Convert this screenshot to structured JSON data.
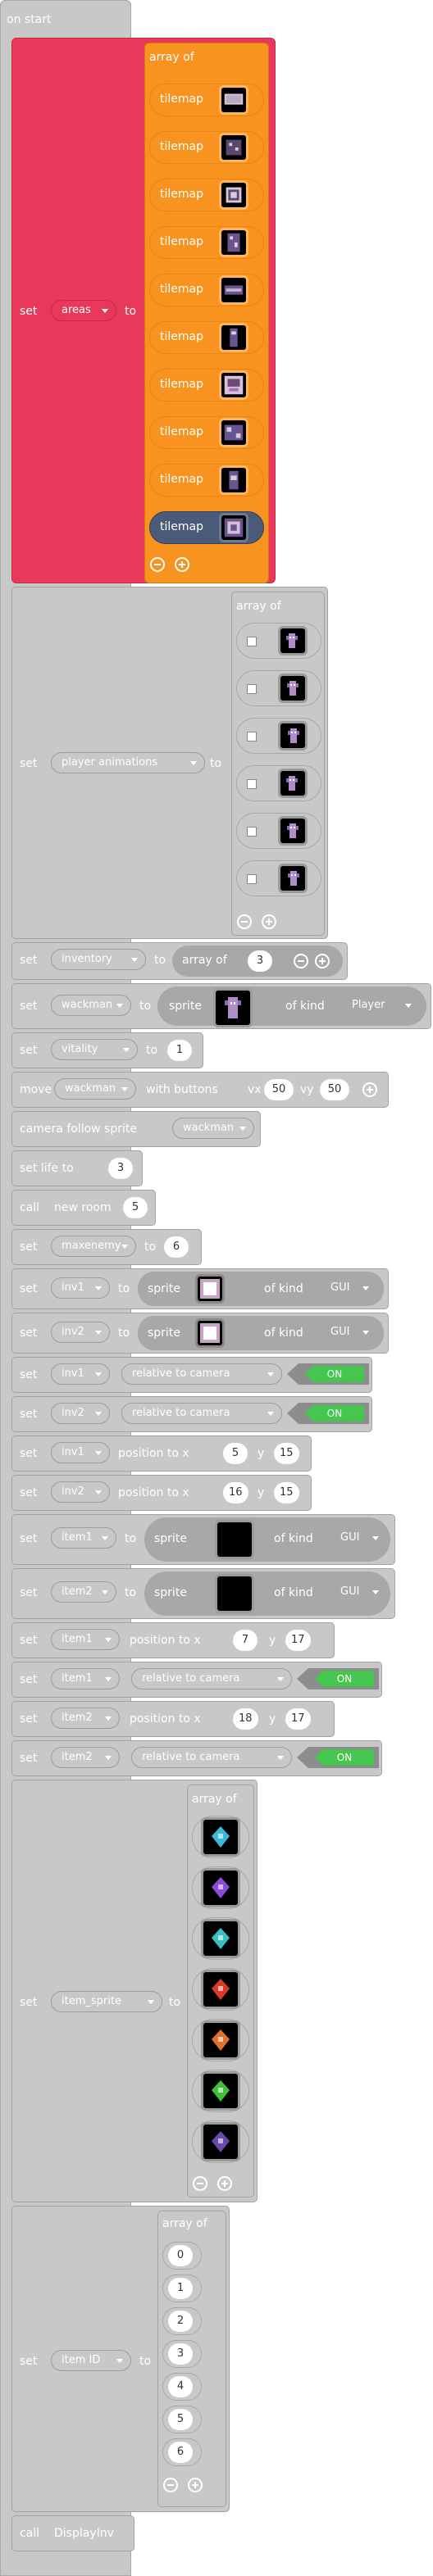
{
  "on_start_label": "on start",
  "areas": {
    "set_label": "set",
    "var_name": "areas",
    "to_label": "to",
    "array_label": "array of",
    "items": [
      "tilemap",
      "tilemap",
      "tilemap",
      "tilemap",
      "tilemap",
      "tilemap",
      "tilemap",
      "tilemap",
      "tilemap",
      "tilemap"
    ]
  },
  "player_animations": {
    "set_label": "set",
    "var_name": "player animations",
    "to_label": "to",
    "array_label": "array of",
    "frame_count": 6
  },
  "inventory": {
    "set_label": "set",
    "var_name": "inventory",
    "to_label": "to",
    "array_label": "array of",
    "count": "3"
  },
  "wackman": {
    "set_label": "set",
    "var_name": "wackman",
    "to_label": "to",
    "sprite_label": "sprite",
    "kind_label": "of kind",
    "kind": "Player"
  },
  "vitality": {
    "set_label": "set",
    "var_name": "vitality",
    "to_label": "to",
    "value": "1"
  },
  "move": {
    "label": "move",
    "var_name": "wackman",
    "with_label": "with buttons",
    "vx_label": "vx",
    "vx": "50",
    "vy_label": "vy",
    "vy": "50"
  },
  "camera": {
    "label": "camera follow sprite",
    "var_name": "wackman"
  },
  "life": {
    "label": "set life to",
    "value": "3"
  },
  "call_new_room": {
    "call_label": "call",
    "fn": "new room",
    "arg": "5"
  },
  "maxenemy": {
    "set_label": "set",
    "var_name": "maxenemy",
    "to_label": "to",
    "value": "6"
  },
  "inv1_sprite": {
    "set_label": "set",
    "var_name": "inv1",
    "to_label": "to",
    "sprite_label": "sprite",
    "kind_label": "of kind",
    "kind": "GUI"
  },
  "inv2_sprite": {
    "set_label": "set",
    "var_name": "inv2",
    "to_label": "to",
    "sprite_label": "sprite",
    "kind_label": "of kind",
    "kind": "GUI"
  },
  "inv1_rel": {
    "set_label": "set",
    "var_name": "inv1",
    "flag": "relative to camera",
    "toggle": "ON"
  },
  "inv2_rel": {
    "set_label": "set",
    "var_name": "inv2",
    "flag": "relative to camera",
    "toggle": "ON"
  },
  "inv1_pos": {
    "set_label": "set",
    "var_name": "inv1",
    "pos_label": "position to x",
    "x": "5",
    "y_label": "y",
    "y": "15"
  },
  "inv2_pos": {
    "set_label": "set",
    "var_name": "inv2",
    "pos_label": "position to x",
    "x": "16",
    "y_label": "y",
    "y": "15"
  },
  "item1_sprite": {
    "set_label": "set",
    "var_name": "item1",
    "to_label": "to",
    "sprite_label": "sprite",
    "kind_label": "of kind",
    "kind": "GUI"
  },
  "item2_sprite": {
    "set_label": "set",
    "var_name": "item2",
    "to_label": "to",
    "sprite_label": "sprite",
    "kind_label": "of kind",
    "kind": "GUI"
  },
  "item1_pos": {
    "set_label": "set",
    "var_name": "item1",
    "pos_label": "position to x",
    "x": "7",
    "y_label": "y",
    "y": "17"
  },
  "item1_rel": {
    "set_label": "set",
    "var_name": "item1",
    "flag": "relative to camera",
    "toggle": "ON"
  },
  "item2_pos": {
    "set_label": "set",
    "var_name": "item2",
    "pos_label": "position to x",
    "x": "18",
    "y_label": "y",
    "y": "17"
  },
  "item2_rel": {
    "set_label": "set",
    "var_name": "item2",
    "flag": "relative to camera",
    "toggle": "ON"
  },
  "item_sprite": {
    "set_label": "set",
    "var_name": "item_sprite",
    "to_label": "to",
    "array_label": "array of",
    "colors": [
      "#3fb8d8",
      "#8a4bd8",
      "#3ac0c0",
      "#d83a2a",
      "#e0702a",
      "#3fbf3a",
      "#6a4aa8"
    ]
  },
  "item_id": {
    "set_label": "set",
    "var_name": "item ID",
    "to_label": "to",
    "array_label": "array of",
    "values": [
      "0",
      "1",
      "2",
      "3",
      "4",
      "5",
      "6"
    ]
  },
  "call_display": {
    "call_label": "call",
    "fn": "DisplayInv"
  },
  "colors": {
    "red_block": "#e8395a",
    "orange_block": "#f7931e",
    "grey_block": "#c8c8c8",
    "dark_pill": "#4a5a78",
    "on_green": "#45c64f"
  }
}
